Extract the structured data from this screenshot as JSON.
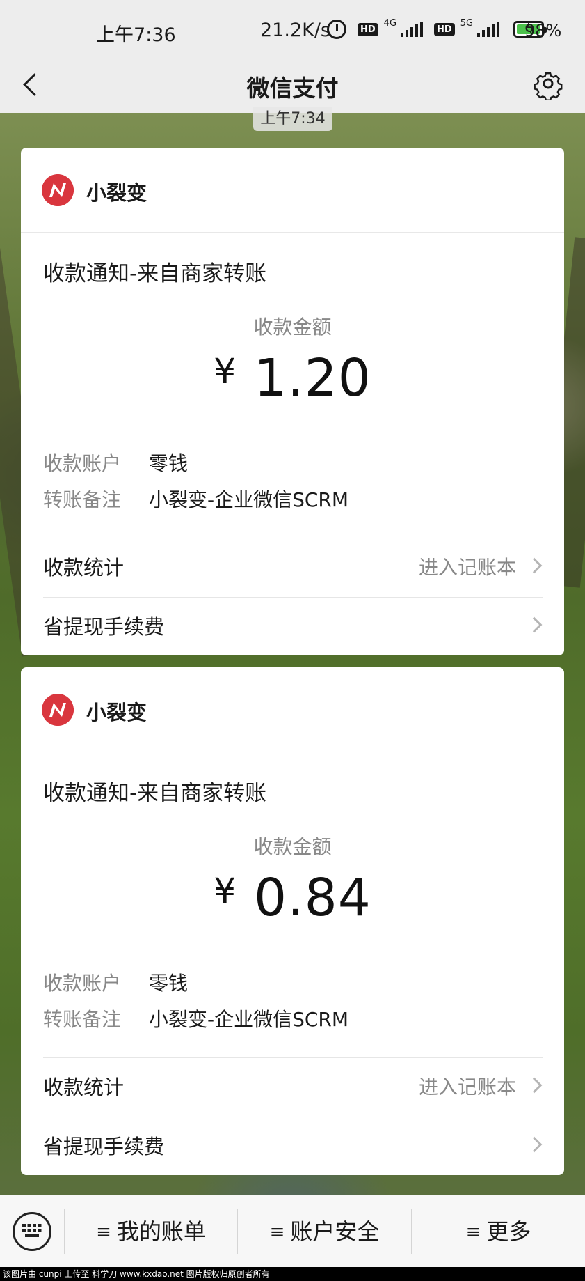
{
  "status_bar": {
    "time": "上午7:36",
    "net_speed": "21.2K/s",
    "hd_badge": "HD",
    "net_4g": "4G",
    "net_5g": "5G",
    "battery_percent": "98%",
    "battery_level": 0.98
  },
  "nav": {
    "title": "微信支付",
    "back_icon": "chevron-left-icon",
    "settings_icon": "gear-icon"
  },
  "message_time": "上午7:34",
  "cards": [
    {
      "brand": "小裂变",
      "title": "收款通知-来自商家转账",
      "amount_label": "收款金额",
      "currency": "¥",
      "amount": "1.20",
      "account_label": "收款账户",
      "account_value": "零钱",
      "note_label": "转账备注",
      "note_value": "小裂变-企业微信SCRM",
      "stats_label": "收款统计",
      "stats_link": "进入记账本",
      "fee_label": "省提现手续费"
    },
    {
      "brand": "小裂变",
      "title": "收款通知-来自商家转账",
      "amount_label": "收款金额",
      "currency": "¥",
      "amount": "0.84",
      "account_label": "收款账户",
      "account_value": "零钱",
      "note_label": "转账备注",
      "note_value": "小裂变-企业微信SCRM",
      "stats_label": "收款统计",
      "stats_link": "进入记账本",
      "fee_label": "省提现手续费"
    }
  ],
  "bottom_bar": {
    "keyboard_icon": "keyboard-icon",
    "menu_glyph": "≡",
    "items": [
      "我的账单",
      "账户安全",
      "更多"
    ]
  },
  "footer_text": "该图片由 cunpi 上传至 科学刀 www.kxdao.net 图片版权归原创者所有",
  "colors": {
    "logo_red": "#d9363e",
    "battery_green": "#4cc24c",
    "bar_bg": "#ededed"
  }
}
